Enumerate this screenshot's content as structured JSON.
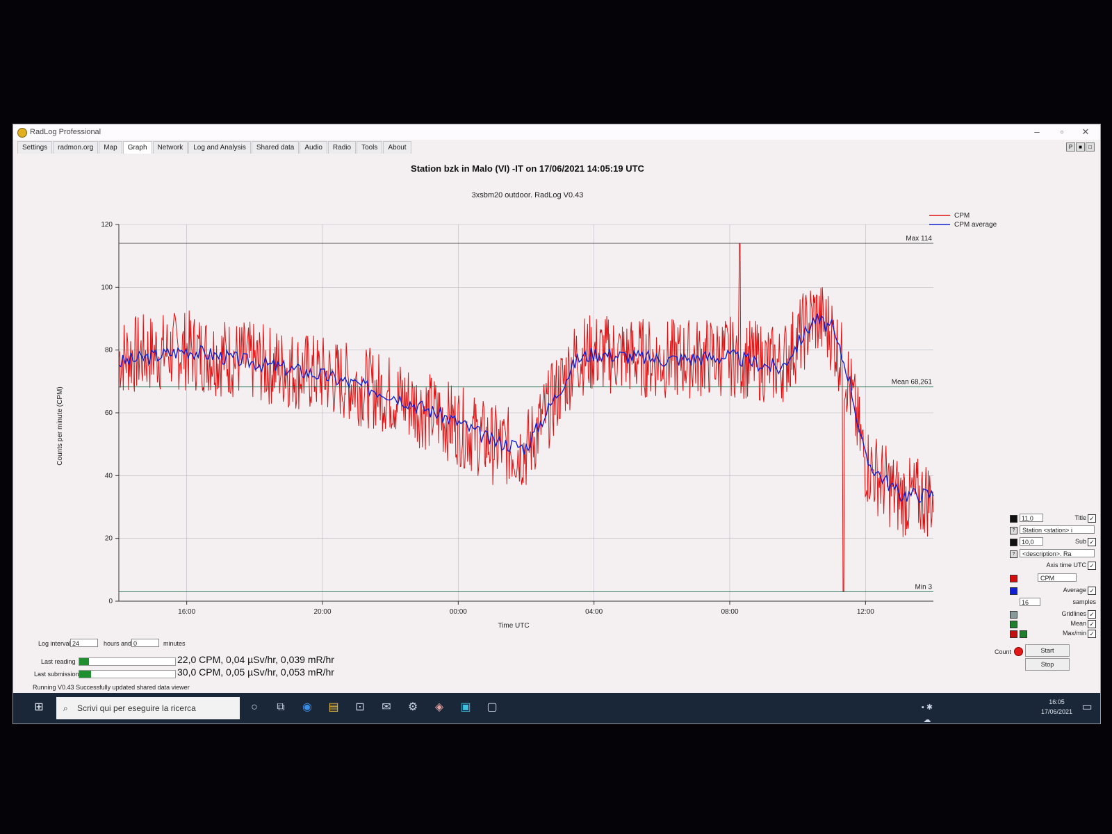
{
  "window": {
    "title": "RadLog Professional"
  },
  "tabs": [
    "Settings",
    "radmon.org",
    "Map",
    "Graph",
    "Network",
    "Log and Analysis",
    "Shared data",
    "Audio",
    "Radio",
    "Tools",
    "About"
  ],
  "active_tab": "Graph",
  "chart_data": {
    "type": "line",
    "title": "Station bzk in Malo (VI) -IT on 17/06/2021 14:05:19 UTC",
    "subtitle": "3xsbm20 outdoor. RadLog V0.43",
    "xlabel": "Time UTC",
    "ylabel": "Counts per minute (CPM)",
    "ylim": [
      0,
      120
    ],
    "yticks": [
      0,
      20,
      40,
      60,
      80,
      100,
      120
    ],
    "xticks": [
      "16:00",
      "20:00",
      "00:00",
      "04:00",
      "08:00",
      "12:00"
    ],
    "x_hours_since_start": [
      0,
      2,
      4,
      6,
      8,
      10,
      11,
      12,
      13.5,
      14,
      16,
      18,
      19.5,
      20.5,
      21,
      21.5,
      22,
      23
    ],
    "series": [
      {
        "name": "CPM",
        "color": "#e01010",
        "values": [
          78,
          80,
          76,
          72,
          66,
          56,
          50,
          48,
          78,
          79,
          77,
          78,
          75,
          91,
          86,
          70,
          44,
          33
        ]
      },
      {
        "name": "CPM average",
        "color": "#1020d0",
        "values": [
          76,
          80,
          76,
          72,
          66,
          57,
          51,
          49,
          77,
          79,
          77,
          78,
          74,
          90,
          87,
          72,
          45,
          34
        ]
      }
    ],
    "annotations": {
      "max_label": "Max 114",
      "mean_label": "Mean 68,261",
      "min_label": "Min 3"
    },
    "max": 114,
    "mean": 68.261,
    "min": 3,
    "grid": true,
    "legend": "top-right"
  },
  "panel": {
    "title_size": "11,0",
    "title_label": "Title",
    "title_text": "Station <station> i",
    "sub_size": "10,0",
    "sub_label": "Sub",
    "sub_text": "<description>. Ra",
    "axis_time_label": "Axis time UTC",
    "series_select": "CPM",
    "average_label": "Average",
    "samples_value": "16",
    "samples_label": "samples",
    "gridlines_label": "Gridlines",
    "mean_label": "Mean",
    "maxmin_label": "Max/min"
  },
  "log_interval": {
    "label": "Log interval",
    "hours": "24",
    "hours_label": "hours and",
    "minutes": "0",
    "minutes_label": "minutes"
  },
  "readings": {
    "last_reading_label": "Last reading",
    "last_reading": "22,0 CPM, 0,04 µSv/hr, 0,039 mR/hr",
    "last_submission_label": "Last submission",
    "last_submission": "30,0 CPM, 0,05 µSv/hr, 0,053 mR/hr"
  },
  "controls": {
    "count_label": "Count",
    "start": "Start",
    "stop": "Stop"
  },
  "status": {
    "state": "Running",
    "version": "V0.43",
    "message": "Successfully updated shared data viewer"
  },
  "taskbar": {
    "search_placeholder": "Scrivi qui per eseguire la ricerca",
    "time": "16:05",
    "date": "17/06/2021"
  }
}
